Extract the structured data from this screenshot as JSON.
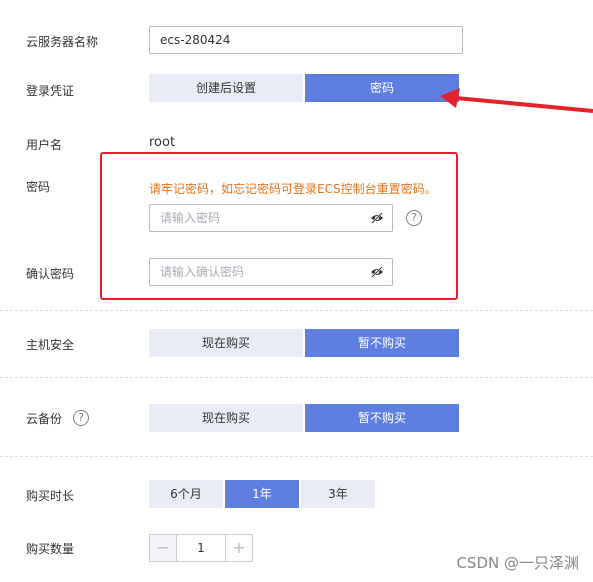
{
  "server_name": {
    "label": "云服务器名称",
    "value": "ecs-280424"
  },
  "login_credential": {
    "label": "登录凭证",
    "options": [
      "创建后设置",
      "密码"
    ],
    "selected": "密码"
  },
  "username": {
    "label": "用户名",
    "value": "root"
  },
  "password": {
    "label": "密码",
    "warning": "请牢记密码，如忘记密码可登录ECS控制台重置密码。",
    "placeholder": "请输入密码",
    "help_icon": "question-circle-icon",
    "toggle_icon": "eye-off-icon"
  },
  "confirm_password": {
    "label": "确认密码",
    "placeholder": "请输入确认密码",
    "toggle_icon": "eye-off-icon"
  },
  "host_security": {
    "label": "主机安全",
    "options": [
      "现在购买",
      "暂不购买"
    ],
    "selected": "暂不购买"
  },
  "cloud_backup": {
    "label": "云备份",
    "help_icon": "question-circle-icon",
    "options": [
      "现在购买",
      "暂不购买"
    ],
    "selected": "暂不购买"
  },
  "duration": {
    "label": "购买时长",
    "options": [
      "6个月",
      "1年",
      "3年"
    ],
    "selected": "1年"
  },
  "quantity": {
    "label": "购买数量",
    "value": "1",
    "minus": "−",
    "plus": "+"
  },
  "watermark": "CSDN @一只泽渊",
  "colors": {
    "accent": "#5f7fe0",
    "segment_off": "#e9ecf5",
    "warning": "#e8741c",
    "highlight": "#e3222a"
  }
}
